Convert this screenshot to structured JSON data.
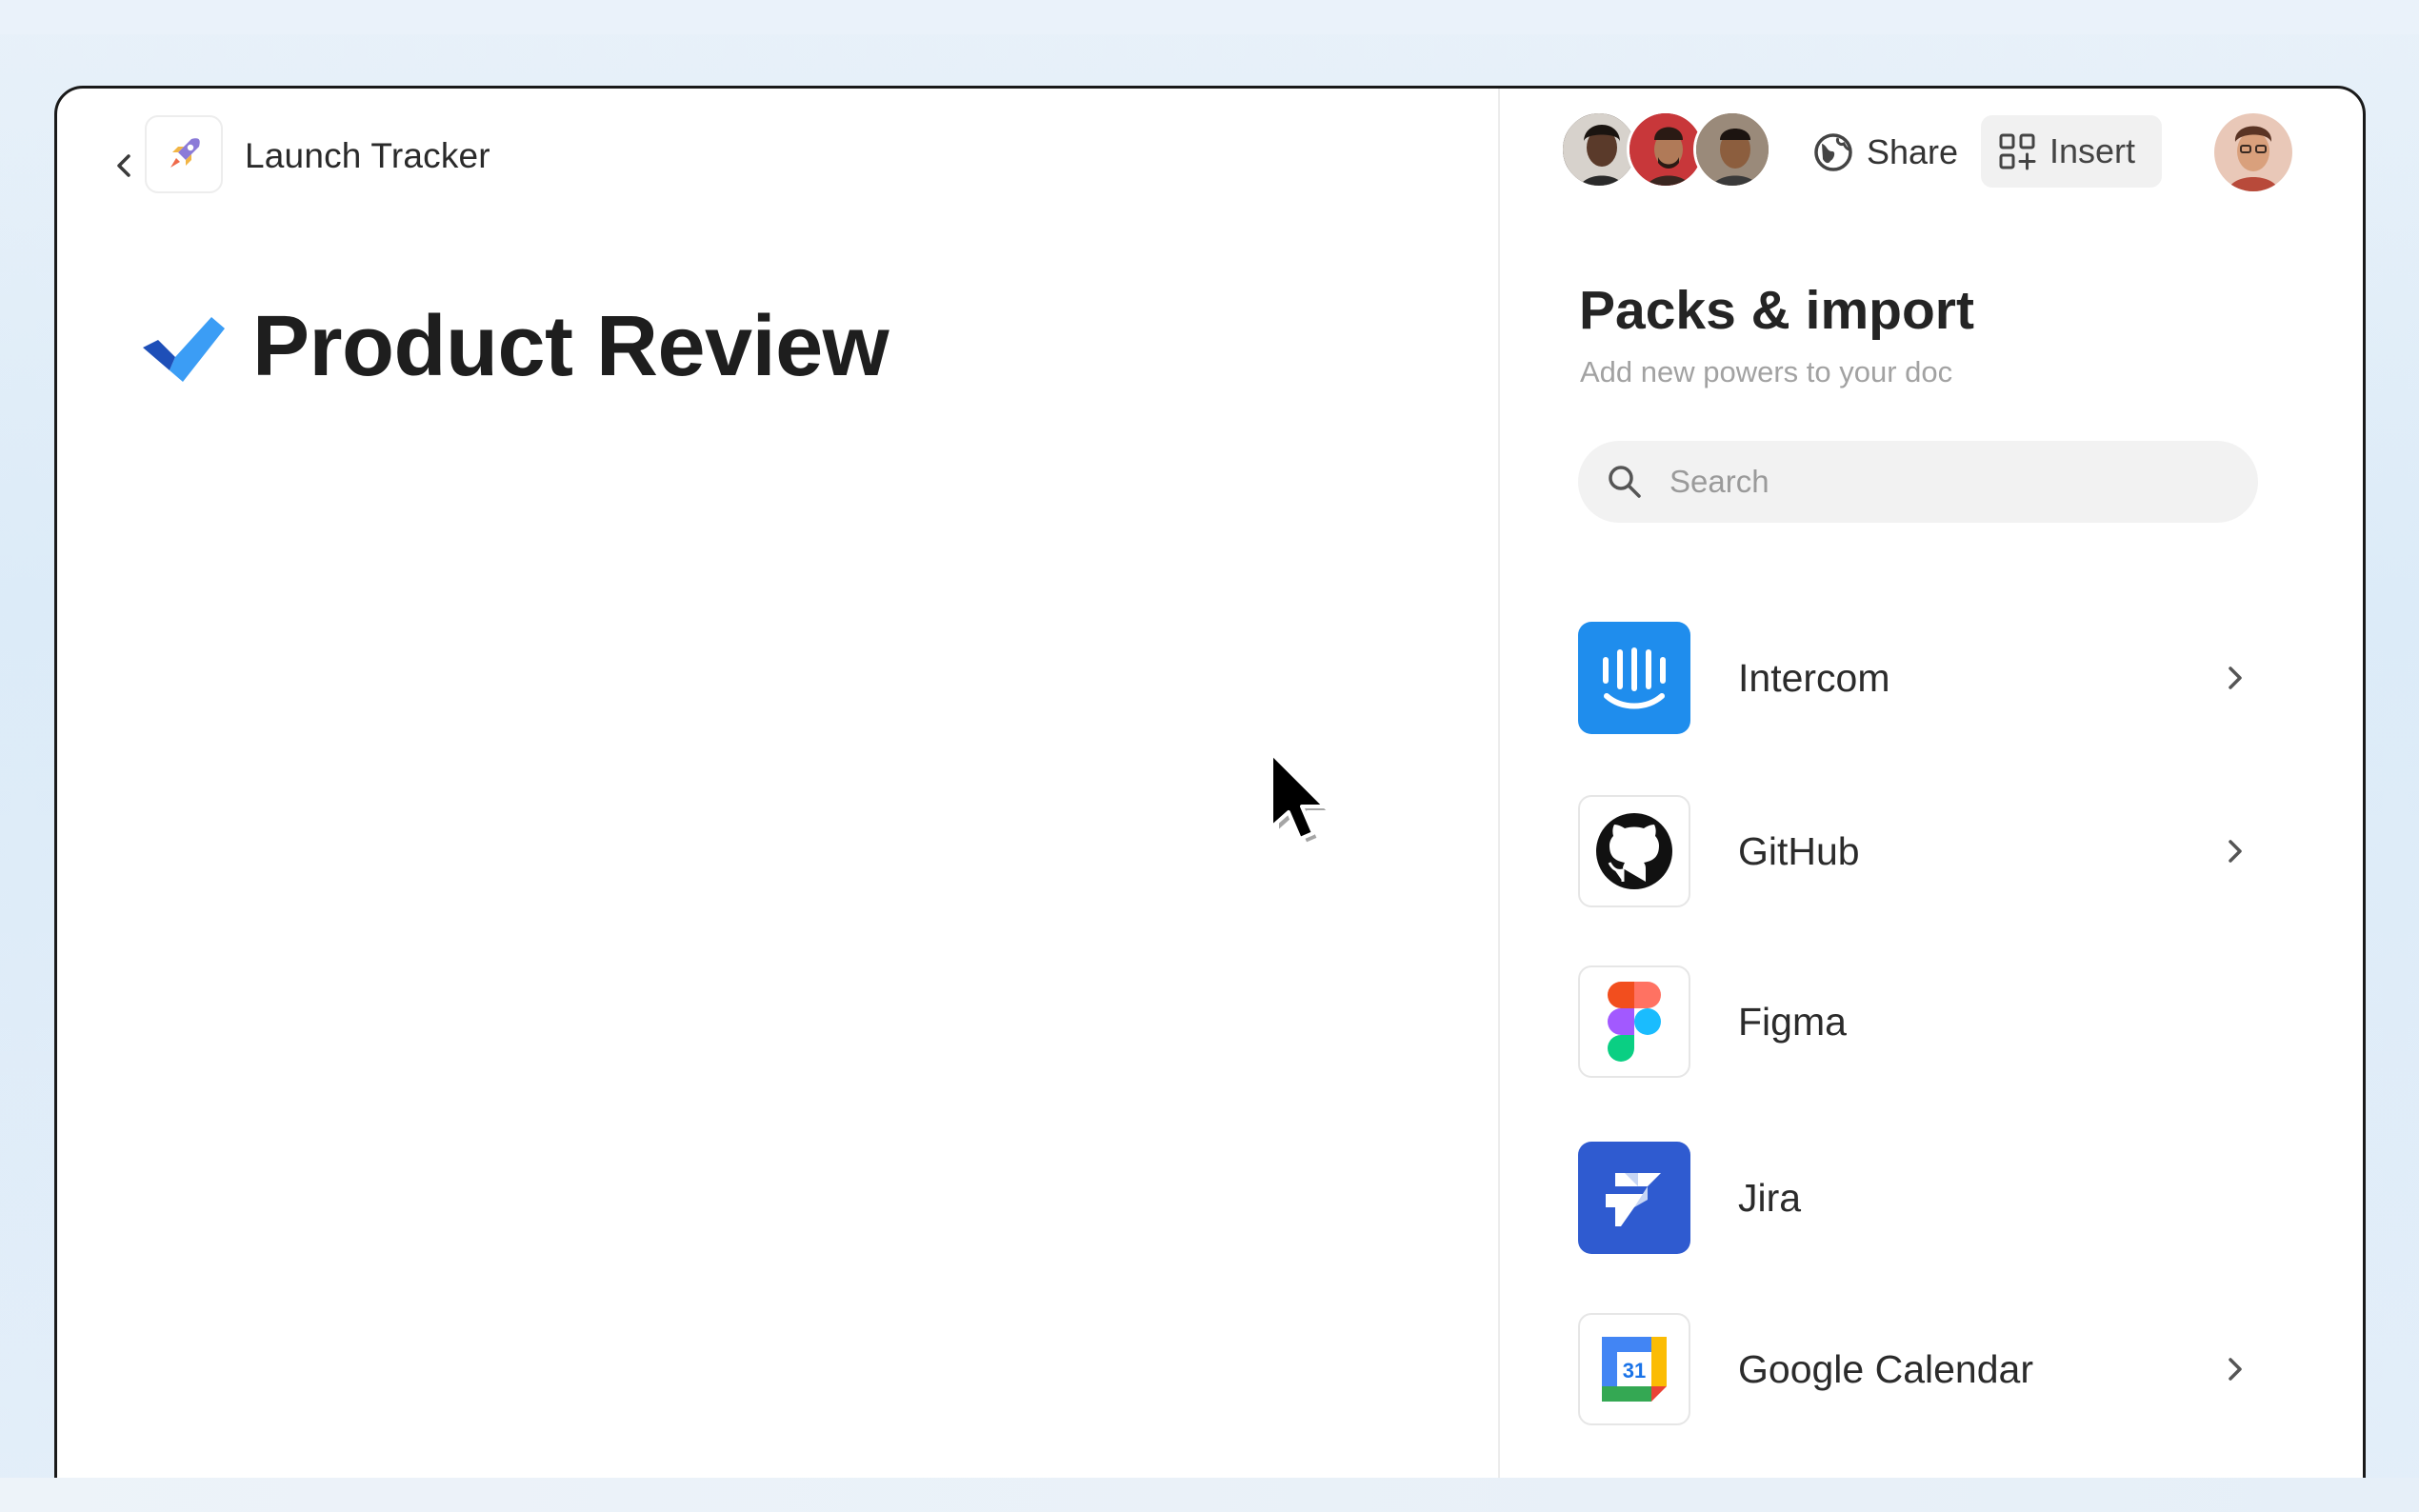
{
  "doc": {
    "title": "Launch Tracker"
  },
  "page": {
    "heading": "Product Review"
  },
  "toolbar": {
    "share_label": "Share",
    "insert_label": "Insert"
  },
  "panel": {
    "title": "Packs & import",
    "subtitle": "Add new powers to your doc",
    "search_placeholder": "Search",
    "packs": [
      {
        "name": "Intercom",
        "icon": "intercom-logo",
        "has_chevron": true
      },
      {
        "name": "GitHub",
        "icon": "github-logo",
        "has_chevron": true
      },
      {
        "name": "Figma",
        "icon": "figma-logo",
        "has_chevron": false
      },
      {
        "name": "Jira",
        "icon": "jira-logo",
        "has_chevron": false
      },
      {
        "name": "Google Calendar",
        "icon": "google-calendar-logo",
        "has_chevron": true,
        "badge": "31"
      }
    ]
  },
  "colors": {
    "intercom": "#1f8ded",
    "jira": "#2f5bd0",
    "check_light": "#3b9df5",
    "check_dark": "#1e4fb8"
  }
}
